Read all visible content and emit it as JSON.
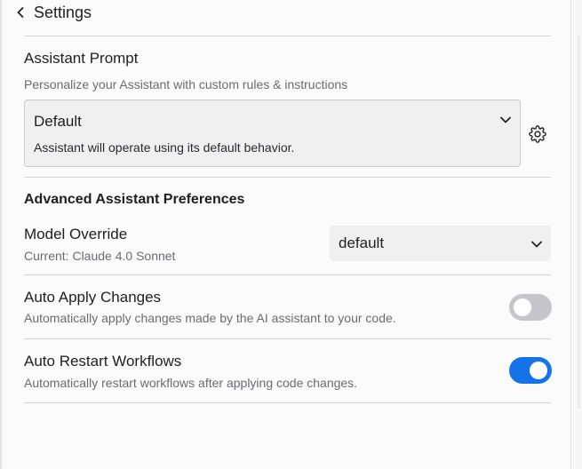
{
  "header": {
    "title": "Settings",
    "back_icon": "chevron-left-icon"
  },
  "assistant_prompt": {
    "title": "Assistant Prompt",
    "description": "Personalize your Assistant with custom rules & instructions",
    "selected_value": "Default",
    "selected_description": "Assistant will operate using its default behavior.",
    "settings_icon": "gear-icon"
  },
  "advanced": {
    "title": "Advanced Assistant Preferences",
    "model_override": {
      "label": "Model Override",
      "current": "Current: Claude 4.0 Sonnet",
      "selected_value": "default"
    },
    "auto_apply": {
      "label": "Auto Apply Changes",
      "description": "Automatically apply changes made by the AI assistant to your code.",
      "enabled": false
    },
    "auto_restart": {
      "label": "Auto Restart Workflows",
      "description": "Automatically restart workflows after applying code changes.",
      "enabled": true
    }
  },
  "colors": {
    "toggle_on": "#1473e6",
    "toggle_off": "#c6c6ca"
  }
}
